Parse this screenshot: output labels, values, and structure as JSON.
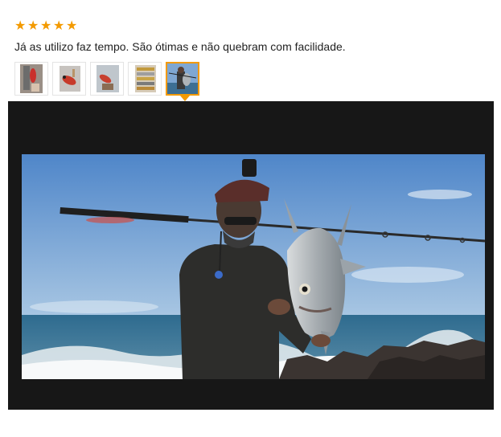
{
  "review": {
    "rating": 5,
    "rating_max": 5,
    "star_color": "#f39a00",
    "text": "Já as utilizo faz tempo. São ótimas e não quebram com facilidade."
  },
  "thumbnails": [
    {
      "icon": "lure-on-hand-thumbnail",
      "selected": false
    },
    {
      "icon": "red-lure-thumbnail",
      "selected": false
    },
    {
      "icon": "lure-package-thumbnail",
      "selected": false
    },
    {
      "icon": "lure-box-thumbnail",
      "selected": false
    },
    {
      "icon": "fisherman-with-fish-thumbnail",
      "selected": true
    }
  ],
  "viewer": {
    "background": "#171717",
    "image": "fisherman holding a large silver fish on rocky beach"
  }
}
